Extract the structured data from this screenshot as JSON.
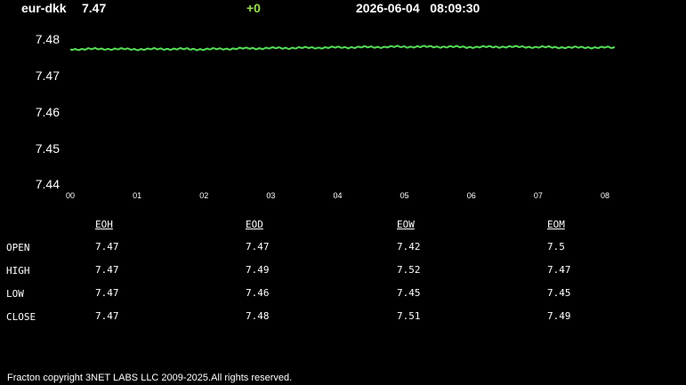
{
  "header": {
    "symbol": "eur-dkk",
    "price": "7.47",
    "change": "+0",
    "datetime": "2026-06-04   08:09:30"
  },
  "colors": {
    "background": "#000000",
    "text": "#ffffff",
    "line": "#55dd55",
    "change": "#9be24a"
  },
  "chart_data": {
    "type": "line",
    "title": "",
    "xlabel": "",
    "ylabel": "",
    "ylim": [
      7.44,
      7.485
    ],
    "yticks": [
      "7.48",
      "7.47",
      "7.46",
      "7.45",
      "7.44"
    ],
    "xticks": [
      "00",
      "01",
      "02",
      "03",
      "04",
      "05",
      "06",
      "07",
      "08"
    ],
    "xlim": [
      0,
      8.15
    ],
    "grid": false,
    "series": [
      {
        "x": [
          0,
          0.5,
          1,
          1.5,
          2,
          2.5,
          3,
          3.5,
          4,
          4.5,
          5,
          5.5,
          6,
          6.5,
          7,
          7.5,
          8,
          8.15
        ],
        "values": [
          7.4772,
          7.4773,
          7.4772,
          7.4773,
          7.4772,
          7.4774,
          7.4775,
          7.4776,
          7.4777,
          7.4778,
          7.4779,
          7.4779,
          7.4778,
          7.4779,
          7.4778,
          7.4777,
          7.4777,
          7.4776
        ]
      }
    ]
  },
  "table": {
    "columns": [
      "EOH",
      "EOD",
      "EOW",
      "EOM"
    ],
    "rows": [
      {
        "label": "OPEN",
        "values": [
          "7.47",
          "7.47",
          "7.42",
          "7.5"
        ]
      },
      {
        "label": "HIGH",
        "values": [
          "7.47",
          "7.49",
          "7.52",
          "7.47"
        ]
      },
      {
        "label": "LOW",
        "values": [
          "7.47",
          "7.46",
          "7.45",
          "7.45"
        ]
      },
      {
        "label": "CLOSE",
        "values": [
          "7.47",
          "7.48",
          "7.51",
          "7.49"
        ]
      }
    ]
  },
  "footer": "Fracton copyright 3NET LABS LLC 2009-2025.All rights reserved."
}
